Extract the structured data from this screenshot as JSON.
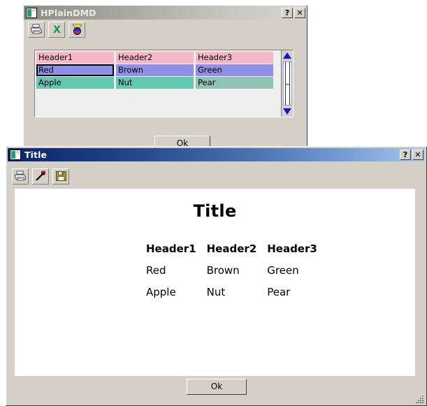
{
  "windows": {
    "plain": {
      "title": "HPlainDMD",
      "icon": "application-icon",
      "state": "inactive",
      "title_buttons": [
        {
          "name": "help-button",
          "label": "?"
        },
        {
          "name": "close-button",
          "label": "✕"
        }
      ],
      "toolbar": [
        {
          "name": "print-button",
          "icon": "printer-icon",
          "label": "Print"
        },
        {
          "name": "export-excel-button",
          "icon": "excel-icon",
          "label": "Export to Excel"
        },
        {
          "name": "award-button",
          "icon": "medal-icon",
          "label": "Award"
        }
      ],
      "grid": {
        "headers": [
          "Header1",
          "Header2",
          "Header3"
        ],
        "rows": [
          [
            "Red",
            "Brown",
            "Green"
          ],
          [
            "Apple",
            "Nut",
            "Pear"
          ]
        ],
        "focused_cell": "Red",
        "colors": {
          "header_bg": "#f4b8c9",
          "row1_bg": "#8f8fe8",
          "row2_bg_a": "#62c8b0",
          "row2_bg_b": "#8fc4b4",
          "grid_bg": "#eeeeee",
          "scroll_arrow": "#1414d8"
        },
        "scrollbar": {
          "name": "vertical-scrollbar",
          "up_arrow": "▲",
          "down_arrow": "▼"
        }
      },
      "ok_label": "Ok"
    },
    "preview": {
      "title": "Title",
      "icon": "application-icon",
      "state": "active",
      "title_buttons": [
        {
          "name": "help-button",
          "label": "?"
        },
        {
          "name": "close-button",
          "label": "✕"
        }
      ],
      "toolbar": [
        {
          "name": "print-button",
          "icon": "printer-icon",
          "label": "Print"
        },
        {
          "name": "export-button",
          "icon": "export-arrow-icon",
          "label": "Export"
        },
        {
          "name": "save-button",
          "icon": "floppy-disk-icon",
          "label": "Save"
        }
      ],
      "document": {
        "title": "Title",
        "headers": [
          "Header1",
          "Header2",
          "Header3"
        ],
        "rows": [
          [
            "Red",
            "Brown",
            "Green"
          ],
          [
            "Apple",
            "Nut",
            "Pear"
          ]
        ]
      },
      "ok_label": "Ok"
    }
  },
  "theme": {
    "face": "#d4d0c8",
    "active_title_start": "#0a246a",
    "active_title_end": "#a6c8ec",
    "inactive_title_start": "#8d8d85",
    "inactive_title_end": "#d6d4ce"
  }
}
